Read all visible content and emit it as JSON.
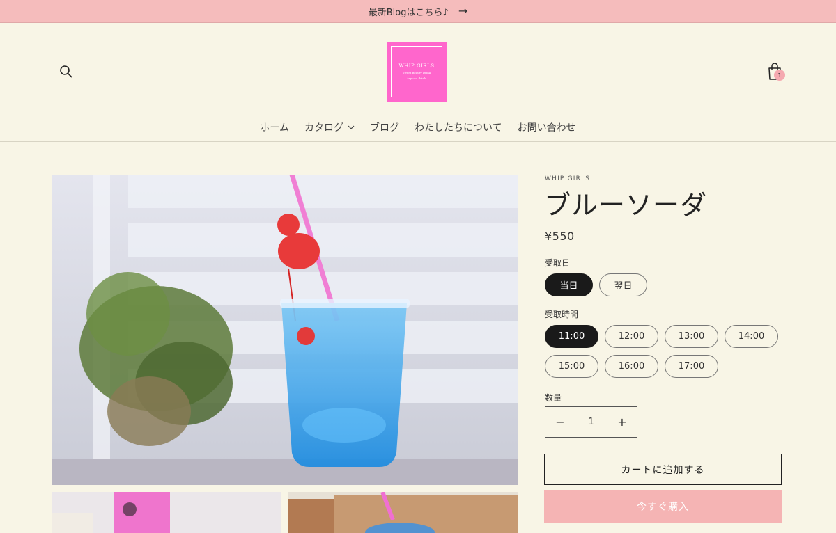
{
  "announcement": {
    "text": "最新Blogはこちら♪",
    "arrow": "→"
  },
  "header": {
    "logo": {
      "title": "WHIP GIRLS",
      "sub1": "Sweet Beauty Drink",
      "sub2": "tapioca drink"
    },
    "cart_count": "1"
  },
  "nav": {
    "items": [
      {
        "label": "ホーム"
      },
      {
        "label": "カタログ"
      },
      {
        "label": "ブログ"
      },
      {
        "label": "わたしたちについて"
      },
      {
        "label": "お問い合わせ"
      }
    ]
  },
  "product": {
    "vendor": "WHIP GIRLS",
    "title": "ブルーソーダ",
    "price": "¥550",
    "pickup_day": {
      "label": "受取日",
      "options": [
        "当日",
        "翌日"
      ],
      "selected": "当日"
    },
    "pickup_time": {
      "label": "受取時間",
      "options": [
        "11:00",
        "12:00",
        "13:00",
        "14:00",
        "15:00",
        "16:00",
        "17:00"
      ],
      "selected": "11:00"
    },
    "quantity": {
      "label": "数量",
      "value": "1",
      "minus": "−",
      "plus": "+"
    },
    "add_to_cart": "カートに追加する",
    "buy_now": "今すぐ購入"
  },
  "colors": {
    "background": "#f8f5e6",
    "announcement_bg": "#f5bcbc",
    "logo_bg": "#ff66cc",
    "selected_pill": "#1a1a1a",
    "buy_now_bg": "#f5b4b4"
  }
}
